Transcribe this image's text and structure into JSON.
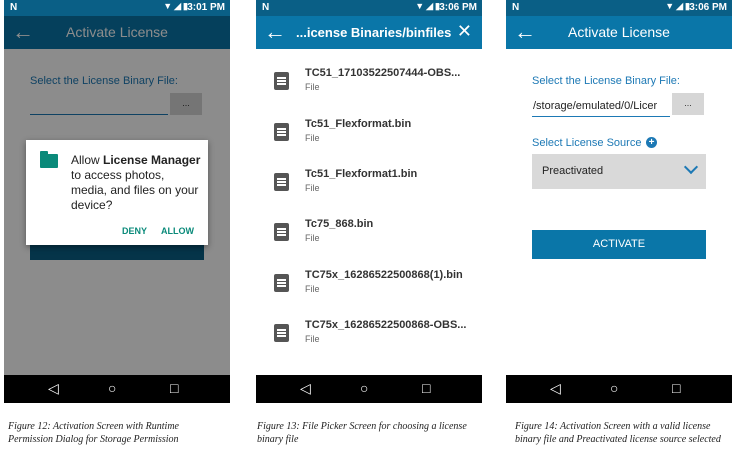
{
  "phone1": {
    "status": {
      "indicator": "N",
      "time": "3:01 PM"
    },
    "title": "Activate License",
    "file_label": "Select the License Binary File:",
    "file_value": "",
    "browse_label": "...",
    "dialog": {
      "message_pre": "Allow ",
      "message_app": "License Manager",
      "message_post": " to access photos, media, and files on your device?",
      "deny": "DENY",
      "allow": "ALLOW"
    }
  },
  "phone2": {
    "status": {
      "indicator": "N",
      "time": "3:06 PM"
    },
    "title": "...icense Binaries/binfiles",
    "files": [
      {
        "name": "TC51_17103522507444-OBS...",
        "type": "File"
      },
      {
        "name": "Tc51_Flexformat.bin",
        "type": "File"
      },
      {
        "name": "Tc51_Flexformat1.bin",
        "type": "File"
      },
      {
        "name": "Tc75_868.bin",
        "type": "File"
      },
      {
        "name": "TC75x_16286522500868(1).bin",
        "type": "File"
      },
      {
        "name": "TC75x_16286522500868-OBS...",
        "type": "File"
      }
    ]
  },
  "phone3": {
    "status": {
      "indicator": "N",
      "time": "3:06 PM"
    },
    "title": "Activate License",
    "file_label": "Select the License Binary File:",
    "file_value": "/storage/emulated/0/Licer",
    "browse_label": "...",
    "source_label": "Select License Source",
    "source_value": "Preactivated",
    "activate_label": "ACTIVATE"
  },
  "captions": {
    "fig12": "Figure 12: Activation Screen with Runtime Permission Dialog for Storage  Permission",
    "fig13": "Figure 13: File Picker Screen for choosing a license binary file",
    "fig14": "Figure 14: Activation Screen with a valid license binary file and Preactivated license source selected"
  },
  "colors": {
    "appbar": "#0a76a8",
    "statusbar": "#0a5f86",
    "accent": "#1d79b5",
    "dialog_action": "#0a8a7a"
  },
  "icons": {
    "back": "arrow-left",
    "close": "x",
    "folder": "folder",
    "file": "document",
    "plus": "plus-circle",
    "chevron": "chevron-down"
  }
}
